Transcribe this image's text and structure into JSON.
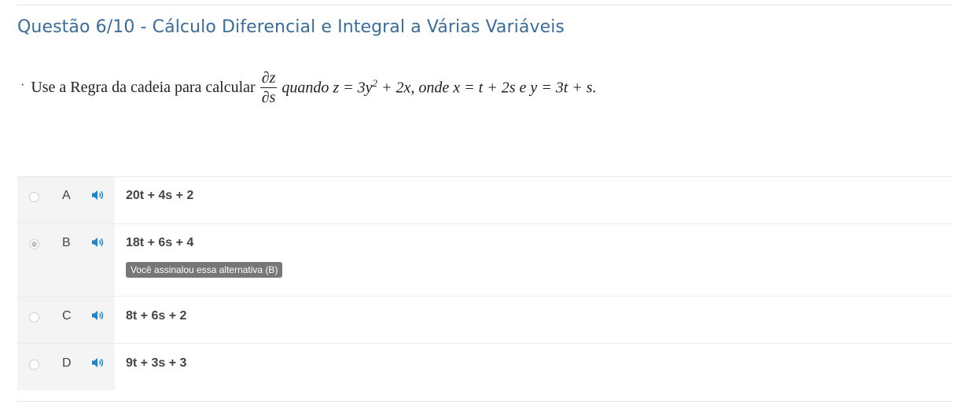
{
  "title": "Questão 6/10 - Cálculo Diferencial e Integral a Várias Variáveis",
  "question": {
    "bullet": "·",
    "lead": "Use a Regra da cadeia para calcular",
    "frac_num": "∂z",
    "frac_den": "∂s",
    "rest_a": "quando z = 3y",
    "rest_sup": "2",
    "rest_b": " + 2x, onde x = t + 2s e y = 3t + s."
  },
  "options": [
    {
      "letter": "A",
      "text": "20t + 4s + 2",
      "selected": false
    },
    {
      "letter": "B",
      "text": "18t + 6s + 4",
      "selected": true,
      "tag": "Você assinalou essa alternativa (B)"
    },
    {
      "letter": "C",
      "text": "8t + 6s + 2",
      "selected": false
    },
    {
      "letter": "D",
      "text": "9t + 3s + 3",
      "selected": false
    }
  ],
  "icons": {
    "audio": "speaker-icon",
    "accent": "#1a85c8"
  }
}
